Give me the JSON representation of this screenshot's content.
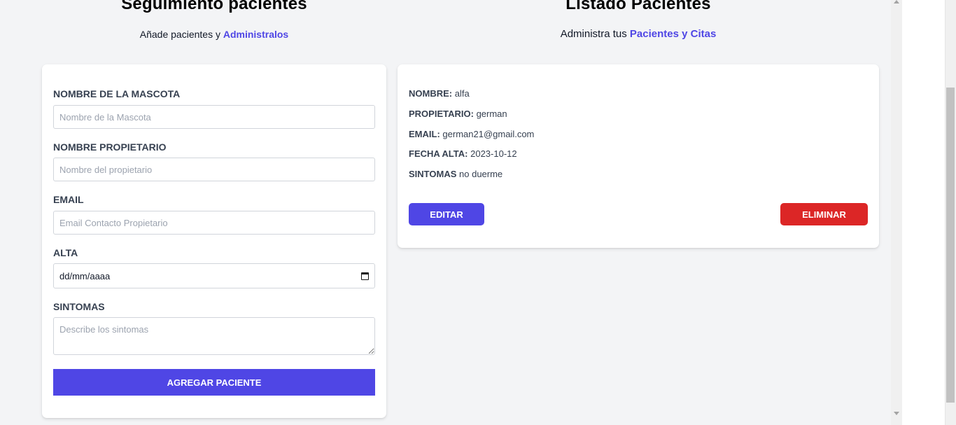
{
  "form_section": {
    "title": "Seguimiento pacientes",
    "subtitle_prefix": "Añade pacientes y",
    "subtitle_accent": "Administralos",
    "fields": {
      "pet_name": {
        "label": "NOMBRE DE LA MASCOTA",
        "placeholder": "Nombre de la Mascota",
        "value": ""
      },
      "owner": {
        "label": "NOMBRE PROPIETARIO",
        "placeholder": "Nombre del propietario",
        "value": ""
      },
      "email": {
        "label": "EMAIL",
        "placeholder": "Email Contacto Propietario",
        "value": ""
      },
      "date": {
        "label": "ALTA",
        "value": "dd/mm/aaaa"
      },
      "symptoms": {
        "label": "SINTOMAS",
        "placeholder": "Describe los sintomas",
        "value": ""
      }
    },
    "submit_label": "AGREGAR PACIENTE"
  },
  "list_section": {
    "title": "Listado Pacientes",
    "subtitle_prefix": "Administra tus",
    "subtitle_accent": "Pacientes y Citas",
    "patients": [
      {
        "name_label": "NOMBRE:",
        "name": "alfa",
        "owner_label": "PROPIETARIO:",
        "owner": "german",
        "email_label": "EMAIL:",
        "email": "german21@gmail.com",
        "date_label": "FECHA ALTA:",
        "date": "2023-10-12",
        "symptoms_label": "SINTOMAS",
        "symptoms": "no duerme",
        "edit_label": "EDITAR",
        "delete_label": "ELIMINAR"
      }
    ]
  },
  "colors": {
    "accent": "#4f46e5",
    "danger": "#dc2626",
    "background": "#f3f4f6"
  }
}
